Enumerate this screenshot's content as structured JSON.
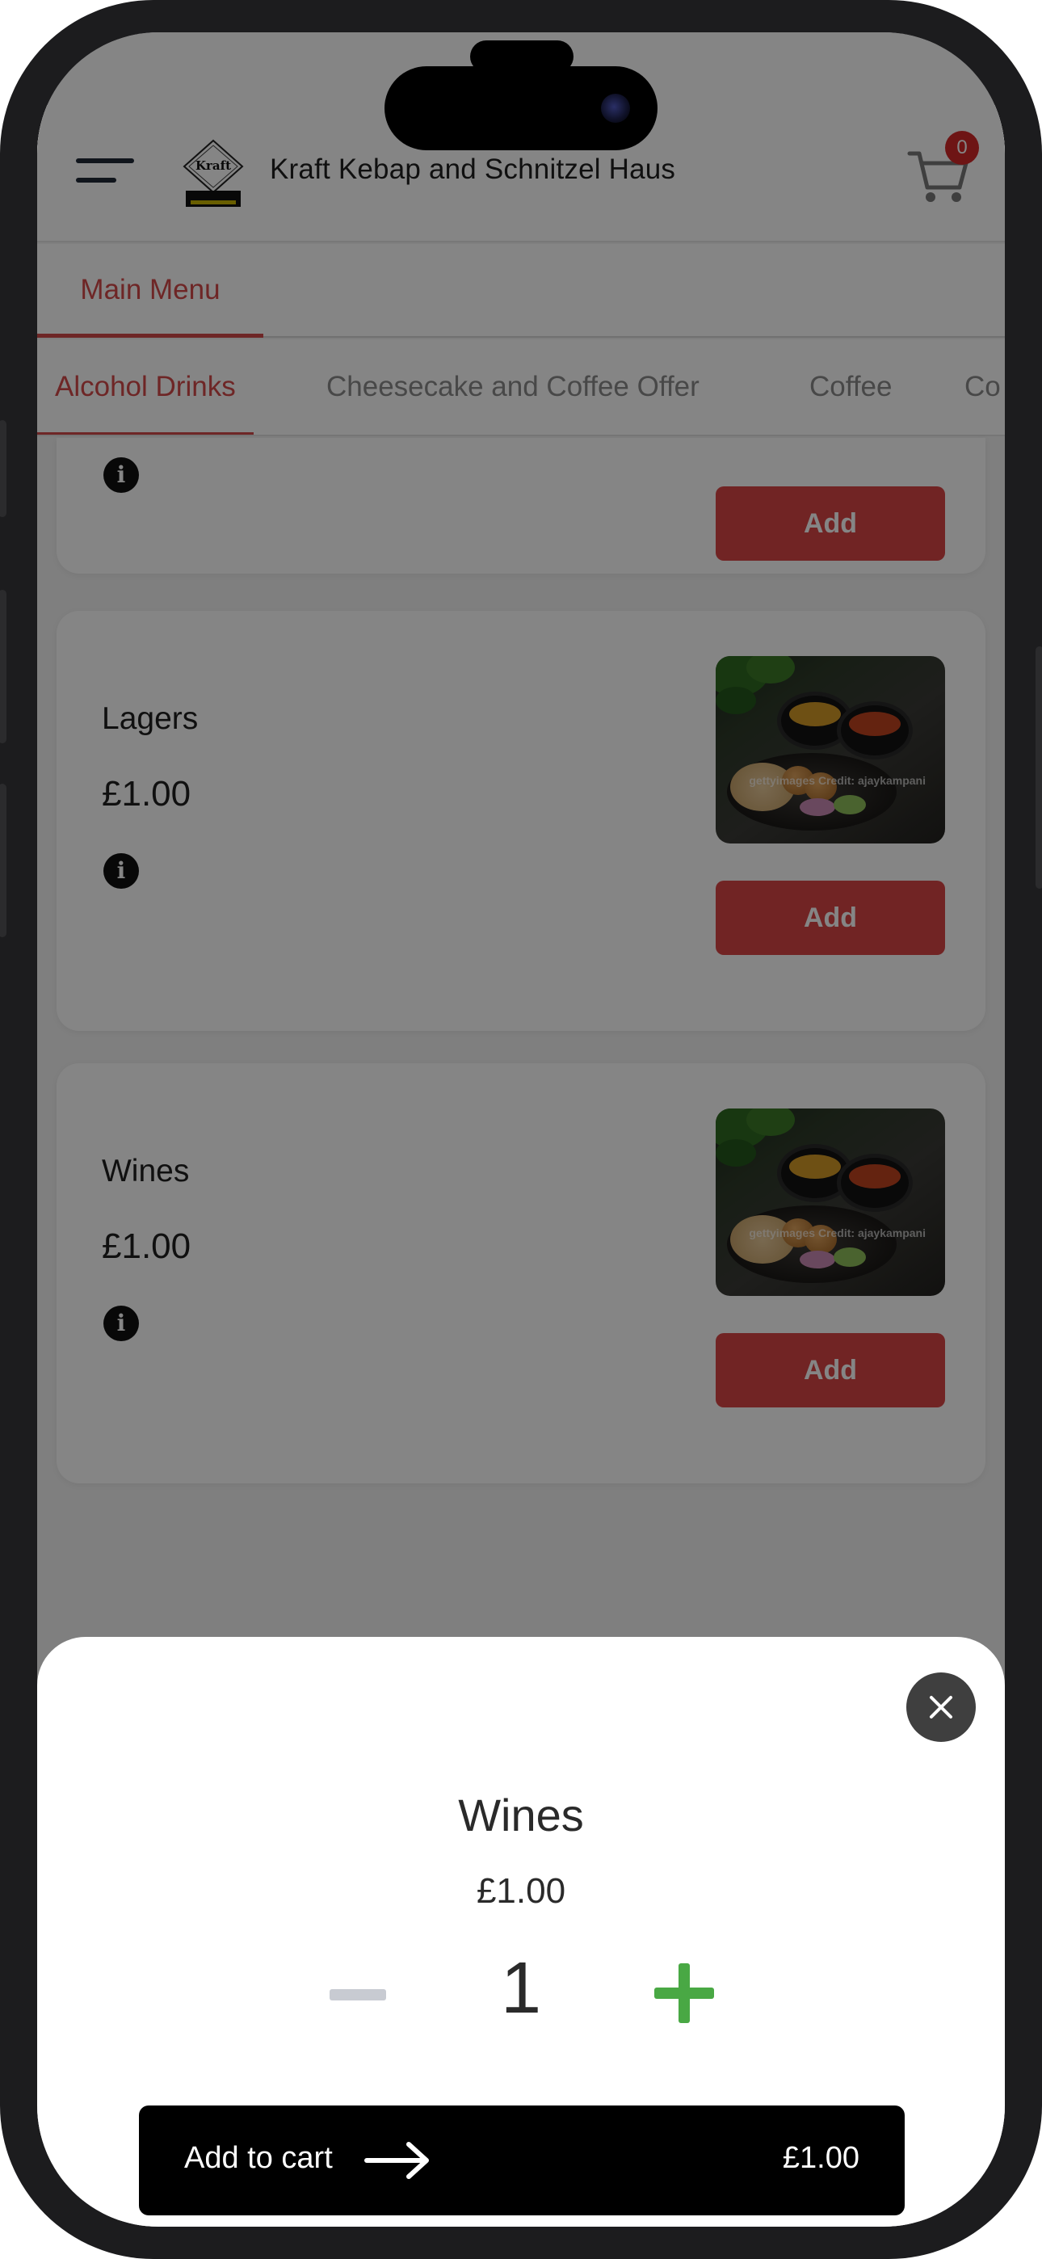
{
  "header": {
    "brand_title": "Kraft Kebap and Schnitzel Haus",
    "logo_text": "Kraft",
    "cart_count": "0"
  },
  "menu_tabs": [
    {
      "label": "Main Menu",
      "active": true
    }
  ],
  "category_tabs": [
    {
      "label": "Alcohol Drinks",
      "active": true
    },
    {
      "label": "Cheesecake and Coffee Offer",
      "active": false
    },
    {
      "label": "Coffee",
      "active": false
    },
    {
      "label": "Co",
      "active": false
    }
  ],
  "items": [
    {
      "name": "",
      "price": "",
      "add_label": "Add"
    },
    {
      "name": "Lagers",
      "price": "£1.00",
      "add_label": "Add",
      "image_watermark": "gettyimages Credit: ajaykampani"
    },
    {
      "name": "Wines",
      "price": "£1.00",
      "add_label": "Add",
      "image_watermark": "gettyimages Credit: ajaykampani"
    }
  ],
  "sheet": {
    "title": "Wines",
    "price": "£1.00",
    "quantity": "1",
    "add_to_cart_label": "Add to cart",
    "total": "£1.00"
  },
  "colors": {
    "accent": "#d94545",
    "plus": "#49a844",
    "minus_disabled": "#c8cbd2"
  },
  "icons": {
    "menu": "hamburger-icon",
    "cart": "cart-icon",
    "info": "info-icon",
    "close": "close-icon",
    "minus": "minus-icon",
    "plus": "plus-icon",
    "arrow": "arrow-right-icon"
  }
}
